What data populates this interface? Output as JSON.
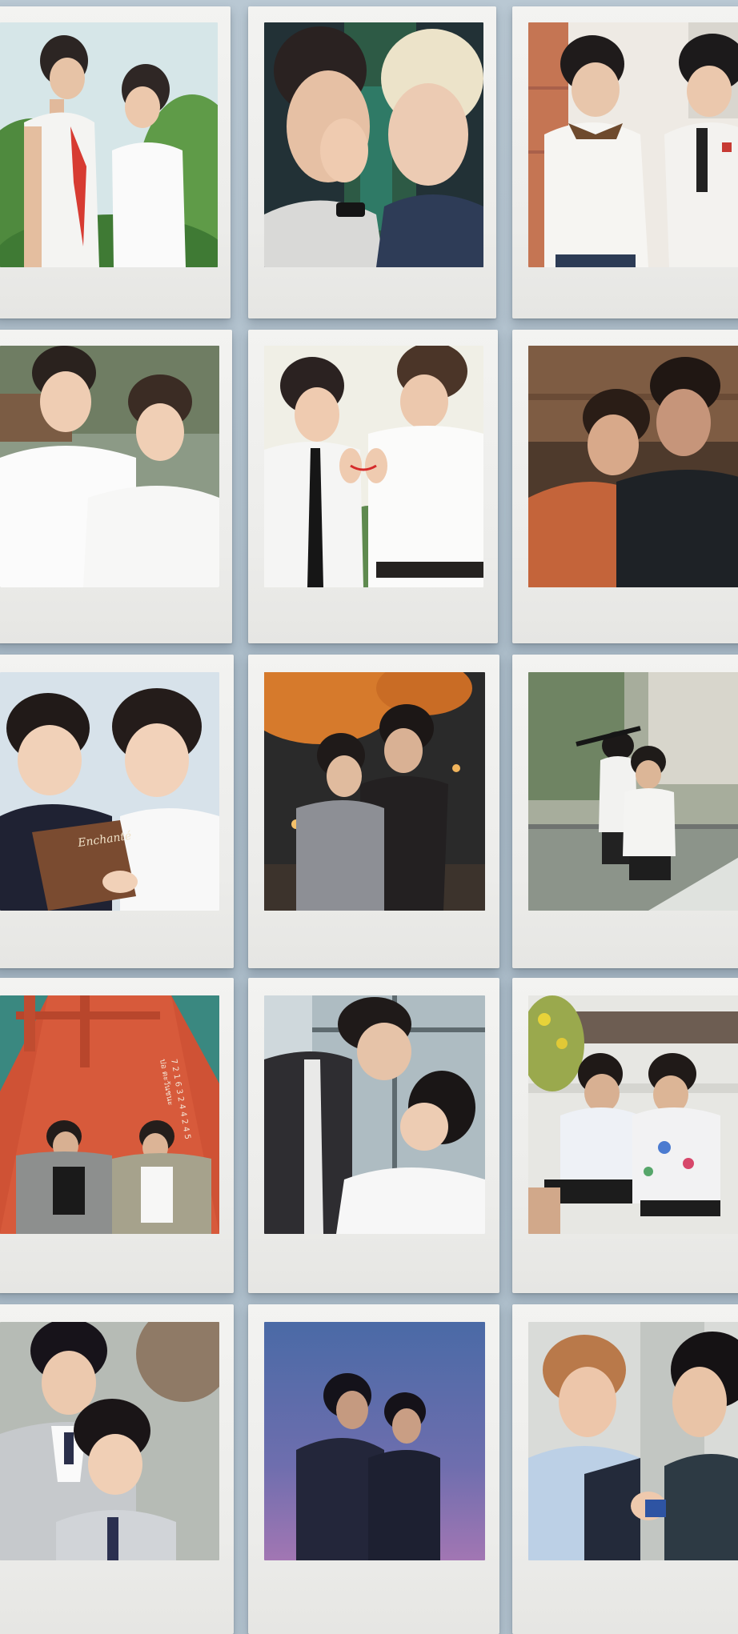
{
  "gallery": {
    "photo_count": 15,
    "photos": [
      {
        "scene": "two young men facing each other outdoors among green trees"
      },
      {
        "scene": "close-up, one hand cupping the other's face, blonde hair"
      },
      {
        "scene": "two young men in white school shirts by a brick wall"
      },
      {
        "scene": "two smiling young men in white shirts"
      },
      {
        "scene": "two young men in white shirts, one with black tie, holding red string"
      },
      {
        "scene": "one man leaning on the other's shoulder, warm light"
      },
      {
        "scene": "two young men reading a book together",
        "book_text": "Enchanté"
      },
      {
        "scene": "embrace at night under orange autumn leaves"
      },
      {
        "scene": "two students running on a bridge in the rain"
      },
      {
        "scene": "two men lying on the bow of a red boat",
        "boat_text": [
          "7 2 1 6 3 2 4 4 2 4 5",
          "ปอ ตะวันชนะ"
        ]
      },
      {
        "scene": "man in suit leaning over another by a window"
      },
      {
        "scene": "two students sitting on a railing, one with paint on shirt"
      },
      {
        "scene": "two young men in grey school blazers"
      },
      {
        "scene": "two men embracing against a purple twilight sky"
      },
      {
        "scene": "two young men close together, one with blond hair"
      }
    ]
  }
}
